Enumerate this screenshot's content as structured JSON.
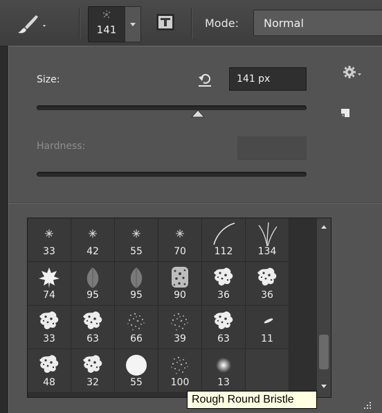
{
  "options_bar": {
    "tool": "brush-tool-icon",
    "brush_size_label": "141",
    "toggle_panel": "brush-panel-toggle-icon",
    "mode_label": "Mode:",
    "mode_value": "Normal"
  },
  "picker": {
    "size_label": "Size:",
    "size_value": "141 px",
    "size_slider_fraction": 0.598,
    "hardness_label": "Hardness:",
    "hardness_value": ""
  },
  "brushes": [
    {
      "label": "33",
      "type": "star"
    },
    {
      "label": "42",
      "type": "star"
    },
    {
      "label": "55",
      "type": "star"
    },
    {
      "label": "70",
      "type": "star"
    },
    {
      "label": "112",
      "type": "stroke"
    },
    {
      "label": "134",
      "type": "grass"
    },
    {
      "label": "74",
      "type": "maple-leaf"
    },
    {
      "label": "95",
      "type": "leaf"
    },
    {
      "label": "95",
      "type": "leaf"
    },
    {
      "label": "90",
      "type": "texture"
    },
    {
      "label": "36",
      "type": "splatter"
    },
    {
      "label": "36",
      "type": "splatter"
    },
    {
      "label": "33",
      "type": "splatter"
    },
    {
      "label": "63",
      "type": "splatter"
    },
    {
      "label": "66",
      "type": "spray"
    },
    {
      "label": "39",
      "type": "spray"
    },
    {
      "label": "63",
      "type": "splatter"
    },
    {
      "label": "11",
      "type": "streak"
    },
    {
      "label": "48",
      "type": "splatter"
    },
    {
      "label": "32",
      "type": "splatter"
    },
    {
      "label": "55",
      "type": "hard-round"
    },
    {
      "label": "100",
      "type": "spray"
    },
    {
      "label": "13",
      "type": "soft-round"
    },
    {
      "label": "",
      "type": "empty"
    }
  ],
  "tooltip": "Rough Round Bristle",
  "colors": {
    "panel_bg": "#535353",
    "grid_bg": "#393939",
    "tooltip_bg": "#ffffe1"
  }
}
